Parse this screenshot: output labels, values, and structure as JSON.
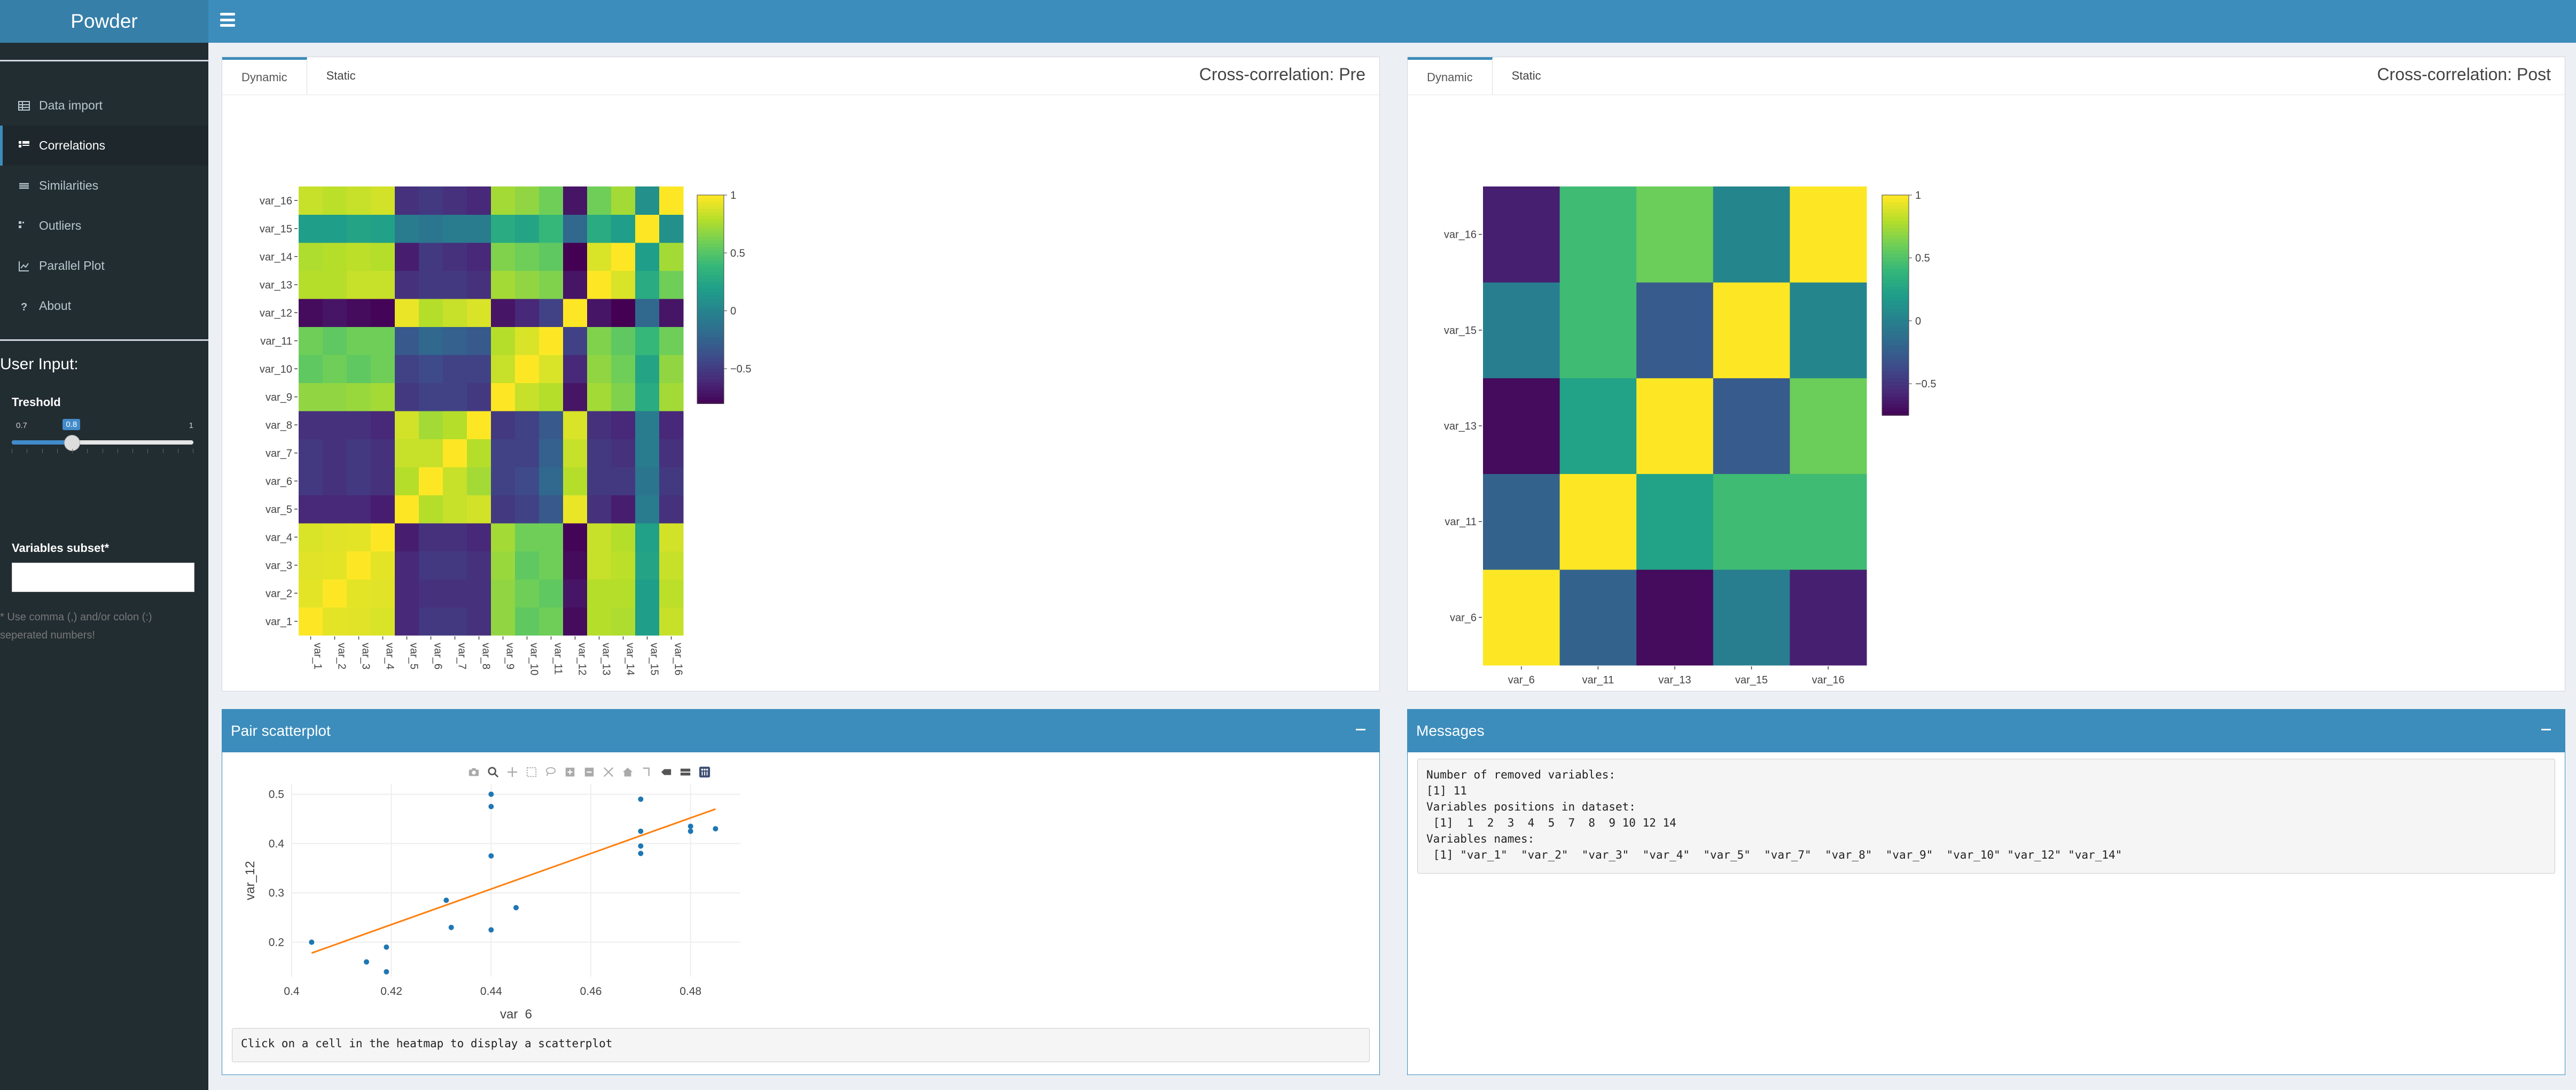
{
  "header": {
    "app_title": "Powder"
  },
  "sidebar": {
    "menu": [
      {
        "label": "Data import",
        "icon": "table-icon",
        "active": false
      },
      {
        "label": "Correlations",
        "icon": "th-icon",
        "active": true
      },
      {
        "label": "Similarities",
        "icon": "equals-icon",
        "active": false
      },
      {
        "label": "Outliers",
        "icon": "th-list-icon",
        "active": false
      },
      {
        "label": "Parallel Plot",
        "icon": "line-chart-icon",
        "active": false
      },
      {
        "label": "About",
        "icon": "question-icon",
        "active": false
      }
    ],
    "user_input_title": "User Input:",
    "threshold": {
      "label": "Treshold",
      "min": "0.7",
      "max": "1",
      "value": "0.8",
      "value_num": 0.8,
      "min_num": 0.7,
      "max_num": 1
    },
    "vars_subset": {
      "label": "Variables subset*",
      "value": ""
    },
    "hint": "* Use comma (,) and/or colon (:) seperated numbers!"
  },
  "pre_box": {
    "tabs": [
      "Dynamic",
      "Static"
    ],
    "active_tab": "Dynamic",
    "title": "Cross-correlation: Pre"
  },
  "post_box": {
    "tabs": [
      "Dynamic",
      "Static"
    ],
    "active_tab": "Dynamic",
    "title": "Cross-correlation: Post"
  },
  "scatter_box": {
    "title": "Pair scatterplot",
    "hint": "Click on a cell in the heatmap to display a scatterplot"
  },
  "messages_box": {
    "title": "Messages",
    "lines": [
      "Number of removed variables:",
      "[1] 11",
      "Variables positions in dataset:",
      " [1]  1  2  3  4  5  7  8  9 10 12 14",
      "Variables names:",
      " [1] \"var_1\"  \"var_2\"  \"var_3\"  \"var_4\"  \"var_5\"  \"var_7\"  \"var_8\"  \"var_9\"  \"var_10\" \"var_12\" \"var_14\""
    ]
  },
  "colors": {
    "header": "#3c8dbc",
    "logo": "#367fa9",
    "sidebar": "#222d32",
    "accent": "#3c8dbc",
    "fit_line": "#ff7f0e",
    "points": "#1f77b4"
  },
  "chart_data": [
    {
      "type": "heatmap",
      "name": "Cross-correlation: Pre",
      "x": [
        "var_1",
        "var_2",
        "var_3",
        "var_4",
        "var_5",
        "var_6",
        "var_7",
        "var_8",
        "var_9",
        "var_10",
        "var_11",
        "var_12",
        "var_13",
        "var_14",
        "var_15",
        "var_16"
      ],
      "y": [
        "var_1",
        "var_2",
        "var_3",
        "var_4",
        "var_5",
        "var_6",
        "var_7",
        "var_8",
        "var_9",
        "var_10",
        "var_11",
        "var_12",
        "var_13",
        "var_14",
        "var_15",
        "var_16"
      ],
      "colorscale": "viridis",
      "zmin": -0.8,
      "zmax": 1,
      "colorbar_ticks": [
        "1",
        "0.5",
        "0",
        "−0.5"
      ],
      "colorbar_tick_values": [
        1,
        0.5,
        0,
        -0.5
      ],
      "z": [
        [
          1,
          0.93,
          0.92,
          0.9,
          -0.6,
          -0.5,
          -0.5,
          -0.55,
          0.7,
          0.55,
          0.6,
          -0.75,
          0.8,
          0.78,
          0.2,
          0.85
        ],
        [
          0.93,
          1,
          0.93,
          0.92,
          -0.6,
          -0.55,
          -0.55,
          -0.55,
          0.7,
          0.6,
          0.55,
          -0.7,
          0.8,
          0.8,
          0.2,
          0.82
        ],
        [
          0.92,
          0.93,
          1,
          0.93,
          -0.6,
          -0.5,
          -0.5,
          -0.55,
          0.72,
          0.55,
          0.6,
          -0.75,
          0.85,
          0.82,
          0.25,
          0.85
        ],
        [
          0.9,
          0.92,
          0.93,
          1,
          -0.65,
          -0.55,
          -0.55,
          -0.6,
          0.75,
          0.6,
          0.6,
          -0.78,
          0.85,
          0.8,
          0.22,
          0.88
        ],
        [
          -0.6,
          -0.6,
          -0.6,
          -0.65,
          1,
          0.8,
          0.85,
          0.88,
          -0.5,
          -0.45,
          -0.3,
          0.95,
          -0.55,
          -0.65,
          -0.05,
          -0.55
        ],
        [
          -0.5,
          -0.55,
          -0.5,
          -0.55,
          0.8,
          1,
          0.85,
          0.75,
          -0.45,
          -0.4,
          -0.2,
          0.8,
          -0.5,
          -0.5,
          -0.1,
          -0.5
        ],
        [
          -0.5,
          -0.55,
          -0.5,
          -0.55,
          0.85,
          0.85,
          1,
          0.8,
          -0.45,
          -0.45,
          -0.25,
          0.85,
          -0.5,
          -0.55,
          -0.05,
          -0.55
        ],
        [
          -0.55,
          -0.55,
          -0.55,
          -0.6,
          0.88,
          0.75,
          0.8,
          1,
          -0.5,
          -0.45,
          -0.3,
          0.9,
          -0.55,
          -0.6,
          -0.05,
          -0.6
        ],
        [
          0.7,
          0.7,
          0.72,
          0.75,
          -0.5,
          -0.45,
          -0.45,
          -0.5,
          1,
          0.85,
          0.8,
          -0.7,
          0.75,
          0.65,
          0.3,
          0.75
        ],
        [
          0.55,
          0.6,
          0.55,
          0.6,
          -0.45,
          -0.4,
          -0.45,
          -0.45,
          0.85,
          1,
          0.9,
          -0.6,
          0.7,
          0.6,
          0.25,
          0.7
        ],
        [
          0.6,
          0.55,
          0.6,
          0.6,
          -0.3,
          -0.2,
          -0.25,
          -0.3,
          0.8,
          0.9,
          1,
          -0.45,
          0.65,
          0.55,
          0.4,
          0.6
        ],
        [
          -0.75,
          -0.7,
          -0.75,
          -0.78,
          0.95,
          0.8,
          0.85,
          0.9,
          -0.7,
          -0.6,
          -0.45,
          1,
          -0.7,
          -0.8,
          -0.2,
          -0.7
        ],
        [
          0.8,
          0.8,
          0.85,
          0.85,
          -0.55,
          -0.5,
          -0.5,
          -0.55,
          0.75,
          0.7,
          0.65,
          -0.7,
          1,
          0.9,
          0.3,
          0.6
        ],
        [
          0.78,
          0.8,
          0.82,
          0.8,
          -0.65,
          -0.5,
          -0.55,
          -0.6,
          0.65,
          0.6,
          0.55,
          -0.8,
          0.9,
          1,
          0.2,
          0.75
        ],
        [
          0.2,
          0.2,
          0.25,
          0.22,
          -0.05,
          -0.1,
          -0.05,
          -0.05,
          0.3,
          0.25,
          0.4,
          -0.2,
          0.3,
          0.2,
          1,
          0.1
        ],
        [
          0.85,
          0.82,
          0.85,
          0.88,
          -0.55,
          -0.5,
          -0.55,
          -0.6,
          0.75,
          0.7,
          0.6,
          -0.7,
          0.6,
          0.75,
          0.1,
          1
        ]
      ]
    },
    {
      "type": "heatmap",
      "name": "Cross-correlation: Post",
      "x": [
        "var_6",
        "var_11",
        "var_13",
        "var_15",
        "var_16"
      ],
      "y": [
        "var_6",
        "var_11",
        "var_13",
        "var_15",
        "var_16"
      ],
      "colorscale": "viridis",
      "zmin": -0.75,
      "zmax": 1,
      "colorbar_ticks": [
        "1",
        "0.5",
        "0",
        "−0.5"
      ],
      "colorbar_tick_values": [
        1,
        0.5,
        0,
        -0.5
      ],
      "z": [
        [
          1,
          -0.2,
          -0.7,
          0,
          -0.6
        ],
        [
          -0.2,
          1,
          0.25,
          0.45,
          0.45
        ],
        [
          -0.7,
          0.25,
          1,
          -0.25,
          0.6
        ],
        [
          0,
          0.45,
          -0.25,
          1,
          0.05
        ],
        [
          -0.6,
          0.45,
          0.6,
          0.05,
          1
        ]
      ]
    },
    {
      "type": "scatter",
      "name": "Pair scatterplot",
      "xlabel": "var_6",
      "ylabel": "var_12",
      "xlim": [
        0.4,
        0.49
      ],
      "ylim": [
        0.13,
        0.52
      ],
      "xticks": [
        0.4,
        0.42,
        0.44,
        0.46,
        0.48
      ],
      "yticks": [
        0.2,
        0.3,
        0.4,
        0.5
      ],
      "points": [
        {
          "x": 0.404,
          "y": 0.2
        },
        {
          "x": 0.415,
          "y": 0.16
        },
        {
          "x": 0.419,
          "y": 0.14
        },
        {
          "x": 0.419,
          "y": 0.19
        },
        {
          "x": 0.431,
          "y": 0.285
        },
        {
          "x": 0.432,
          "y": 0.23
        },
        {
          "x": 0.44,
          "y": 0.5
        },
        {
          "x": 0.44,
          "y": 0.475
        },
        {
          "x": 0.44,
          "y": 0.375
        },
        {
          "x": 0.44,
          "y": 0.225
        },
        {
          "x": 0.445,
          "y": 0.27
        },
        {
          "x": 0.47,
          "y": 0.49
        },
        {
          "x": 0.47,
          "y": 0.425
        },
        {
          "x": 0.47,
          "y": 0.395
        },
        {
          "x": 0.47,
          "y": 0.38
        },
        {
          "x": 0.48,
          "y": 0.435
        },
        {
          "x": 0.48,
          "y": 0.425
        },
        {
          "x": 0.485,
          "y": 0.43
        }
      ],
      "fit_line": [
        {
          "x": 0.404,
          "y": 0.178
        },
        {
          "x": 0.485,
          "y": 0.47
        }
      ]
    }
  ]
}
